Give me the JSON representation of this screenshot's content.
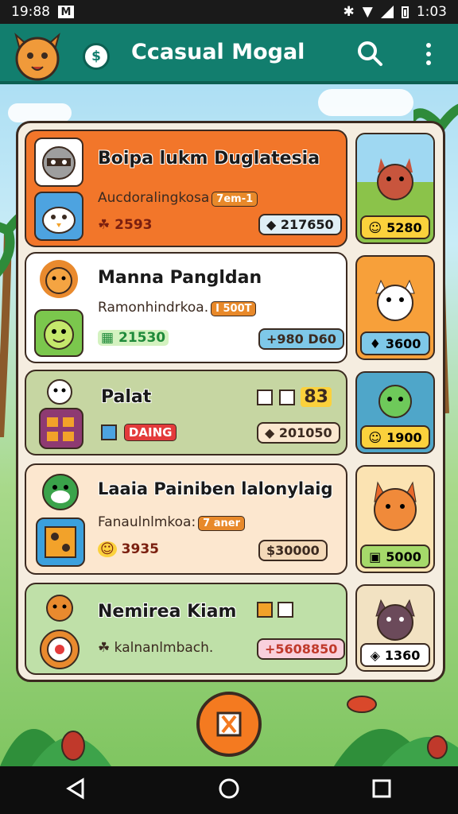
{
  "status_bar": {
    "time": "19:88",
    "mail_icon": "M",
    "battery_text": "1:03",
    "icons": [
      "bluetooth-icon",
      "wifi-icon",
      "signal-icon",
      "battery-icon"
    ]
  },
  "app_bar": {
    "title": "Ccasual Mogal",
    "coin_symbol": "$",
    "icons": [
      "cat-logo-icon",
      "coin-icon",
      "search-icon",
      "more-vert-icon"
    ]
  },
  "games": [
    {
      "title": "Boipa lukm Duglatesia",
      "subtitle": "Aucdoralingkosa",
      "tag": "7em-1",
      "score": "2593",
      "cost": "◆ 217650",
      "thumb_value": "5280",
      "colors": {
        "bg": "#f2762a",
        "thumb": "#8bc34a",
        "badge": "#fbd13c"
      }
    },
    {
      "title": "Manna Pangldan",
      "subtitle": "Ramonhindrkoa.",
      "tag": "I 500T",
      "score": "21530",
      "cost": "+980 D60",
      "thumb_value": "3600",
      "colors": {
        "bg": "#ffffff",
        "thumb": "#f7a03a",
        "badge": "#7ec8e8"
      }
    },
    {
      "title": "Palat",
      "subtitle": "",
      "tag": "DAING",
      "extra": "83",
      "cost": "◆ 201050",
      "thumb_value": "1900",
      "colors": {
        "bg": "#c6d6a2",
        "thumb": "#4fa6c9",
        "badge": "#fbd13c"
      }
    },
    {
      "title": "Laaia Painiben lalonylaig",
      "subtitle": "Fanaulnlmkoa:",
      "tag": "7 aner",
      "score": "3935",
      "cost": "$30000",
      "thumb_value": "5000",
      "colors": {
        "bg": "#fce7cf",
        "thumb": "#fbe3b2",
        "badge": "#a5d96a"
      }
    },
    {
      "title": "Nemirea Kiam",
      "subtitle": "kalnanlmbach.",
      "cost": "+5608850",
      "thumb_value": "1360",
      "colors": {
        "bg": "#bfe0a8",
        "thumb": "#f2e2c2",
        "badge": "#ffffff"
      }
    }
  ],
  "fab": {
    "icon": "bookmark-play-icon"
  },
  "nav_bar": {
    "icons": [
      "back-icon",
      "home-icon",
      "recents-icon"
    ]
  }
}
